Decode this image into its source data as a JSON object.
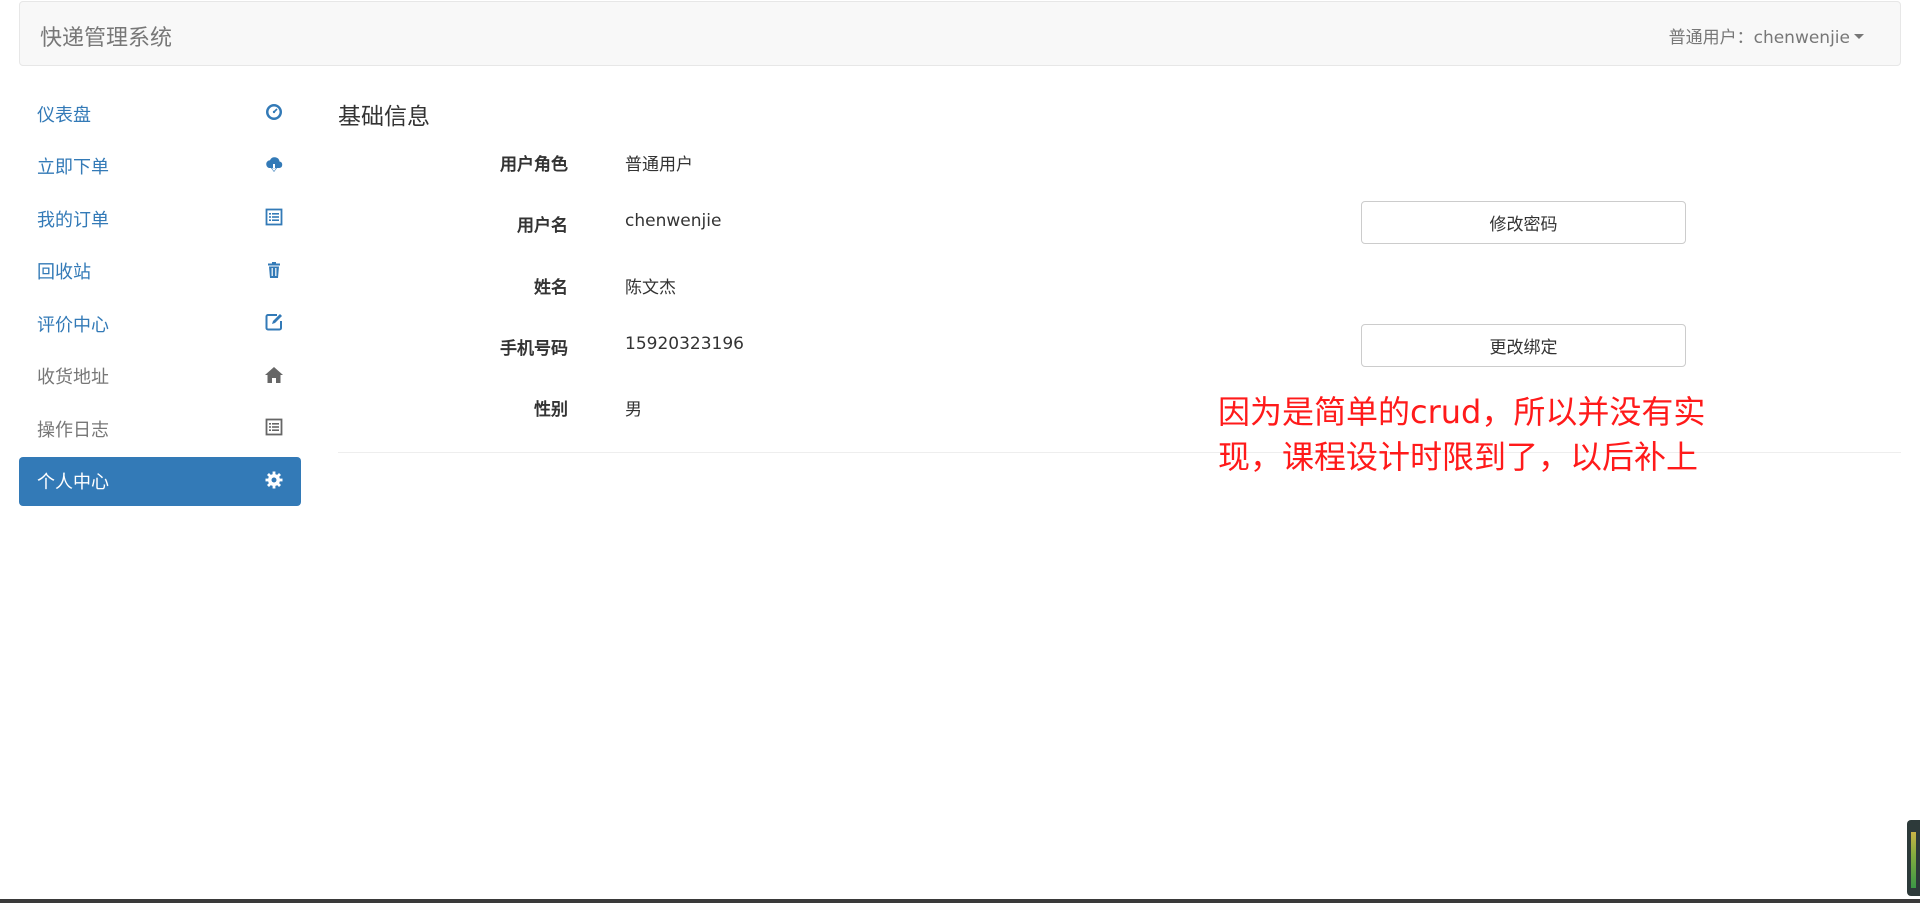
{
  "header": {
    "brand": "快递管理系统",
    "user_menu": "普通用户：chenwenjie"
  },
  "sidebar": {
    "items": [
      {
        "label": "仪表盘",
        "icon": "dashboard-icon"
      },
      {
        "label": "立即下单",
        "icon": "cloud-download-icon"
      },
      {
        "label": "我的订单",
        "icon": "list-alt-icon"
      },
      {
        "label": "回收站",
        "icon": "trash-icon"
      },
      {
        "label": "评价中心",
        "icon": "edit-icon"
      },
      {
        "label": "收货地址",
        "icon": "home-icon"
      },
      {
        "label": "操作日志",
        "icon": "list-alt-icon"
      },
      {
        "label": "个人中心",
        "icon": "cog-icon",
        "active": true
      }
    ]
  },
  "main": {
    "section_title": "基础信息",
    "fields": [
      {
        "label": "用户角色",
        "value": "普通用户"
      },
      {
        "label": "用户名",
        "value": "chenwenjie",
        "button": "修改密码"
      },
      {
        "label": "姓名",
        "value": "陈文杰"
      },
      {
        "label": "手机号码",
        "value": "15920323196",
        "button": "更改绑定"
      },
      {
        "label": "性别",
        "value": "男"
      }
    ]
  },
  "annotation": "因为是简单的crud，所以并没有实现，课程设计时限到了，以后补上",
  "colors": {
    "link": "#337ab7",
    "active_bg": "#337ab7",
    "annotation": "#ff1a1a"
  }
}
